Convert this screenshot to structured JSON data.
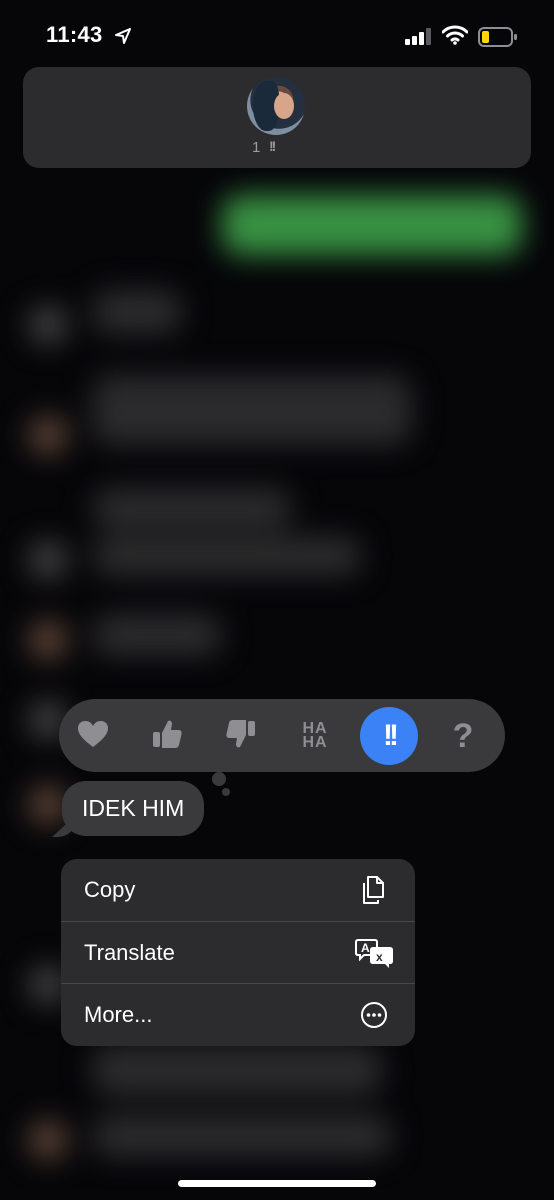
{
  "status_bar": {
    "time": "11:43",
    "icons": [
      "location-arrow-icon",
      "cellular-signal-icon",
      "wifi-icon",
      "battery-low-icon"
    ]
  },
  "reactions_summary": {
    "count": "1",
    "reaction_icon": "!!"
  },
  "tapback_bar": {
    "options": [
      {
        "name": "heart",
        "icon": "heart-icon",
        "selected": false
      },
      {
        "name": "thumbs-up",
        "icon": "thumbs-up-icon",
        "selected": false
      },
      {
        "name": "thumbs-down",
        "icon": "thumbs-down-icon",
        "selected": false
      },
      {
        "name": "haha",
        "icon": "haha-icon",
        "label_top": "HA",
        "label_bottom": "HA",
        "selected": false
      },
      {
        "name": "emphasize",
        "icon": "exclamation-icon",
        "label": "!!",
        "selected": true
      },
      {
        "name": "question",
        "icon": "question-icon",
        "label": "?",
        "selected": false
      }
    ]
  },
  "message": {
    "text": "IDEK HIM"
  },
  "context_menu": {
    "items": [
      {
        "label": "Copy",
        "icon": "copy-icon"
      },
      {
        "label": "Translate",
        "icon": "translate-icon"
      },
      {
        "label": "More...",
        "icon": "more-icon"
      }
    ]
  },
  "colors": {
    "accent": "#3b82f6",
    "menu_bg": "#2c2c2e",
    "bubble_bg": "#3a3a3c",
    "sent_green": "#4cc35a"
  }
}
